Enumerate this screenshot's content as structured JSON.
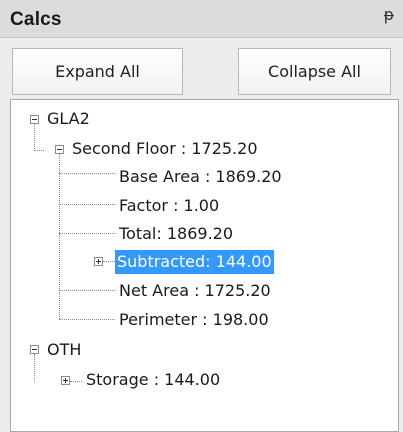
{
  "panel": {
    "title": "Calcs",
    "pin_glyph": "ᵽ"
  },
  "buttons": {
    "expand_all": "Expand All",
    "collapse_all": "Collapse All"
  },
  "tree": {
    "nodes": [
      {
        "id": "gla2",
        "label": "GLA2",
        "expanded": true
      },
      {
        "id": "second-floor",
        "label": "Second Floor : 1725.20",
        "expanded": true
      },
      {
        "id": "base-area",
        "label": "Base Area : 1869.20"
      },
      {
        "id": "factor",
        "label": "Factor : 1.00"
      },
      {
        "id": "total",
        "label": "Total: 1869.20"
      },
      {
        "id": "subtracted",
        "label": "Subtracted: 144.00",
        "expanded": false,
        "selected": true
      },
      {
        "id": "net-area",
        "label": "Net Area : 1725.20"
      },
      {
        "id": "perimeter",
        "label": "Perimeter : 198.00"
      },
      {
        "id": "oth",
        "label": "OTH",
        "expanded": true
      },
      {
        "id": "storage",
        "label": "Storage : 144.00",
        "expanded": false
      }
    ]
  },
  "colors": {
    "selection": "#3399ff",
    "selection_text": "#ffffff",
    "tree_background": "#ffffff",
    "panel_background": "#ececec"
  }
}
